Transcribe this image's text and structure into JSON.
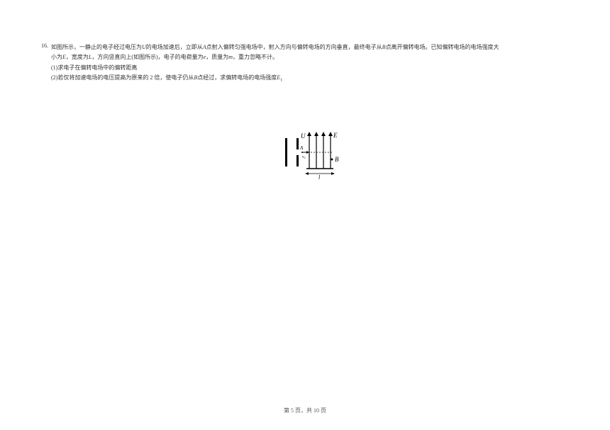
{
  "question": {
    "number": "16.",
    "line1_a": "如图所示，一静止的电子经过电压为",
    "var_U": "U",
    "line1_b": "的电场加速后，立即从",
    "var_A": "A",
    "line1_c": "点射入偏转匀强电场中，射入方向与偏转电场的方向垂直，最终电子从",
    "var_B": "B",
    "line1_d": "点离开偏转电场。已知偏转电场的电场强度大",
    "line2_a": "小为",
    "var_E": "E",
    "line2_b": "，宽度为",
    "var_L": "L",
    "line2_c": "，方向竖直向上(如图所示)，电子的电荷量为",
    "var_e": "e",
    "line2_d": "，质量为",
    "var_m": "m",
    "line2_e": "，重力忽略不计。",
    "sub1": "(1)求电子在偏转电场中的偏转距离",
    "sub2_a": "(2)若仅将加速电场的电压提高为原来的 2 倍，使电子仍从",
    "sub2_b": "点经过，求偏转电场的电场强度",
    "var_E1": "E",
    "var_E1_sub": "1"
  },
  "diagram": {
    "label_U": "U",
    "label_E": "E",
    "label_A": "A",
    "label_v0": "v₀",
    "label_B": "B",
    "label_l": "l"
  },
  "footer": {
    "page": "第 5 页，共 10 页"
  }
}
